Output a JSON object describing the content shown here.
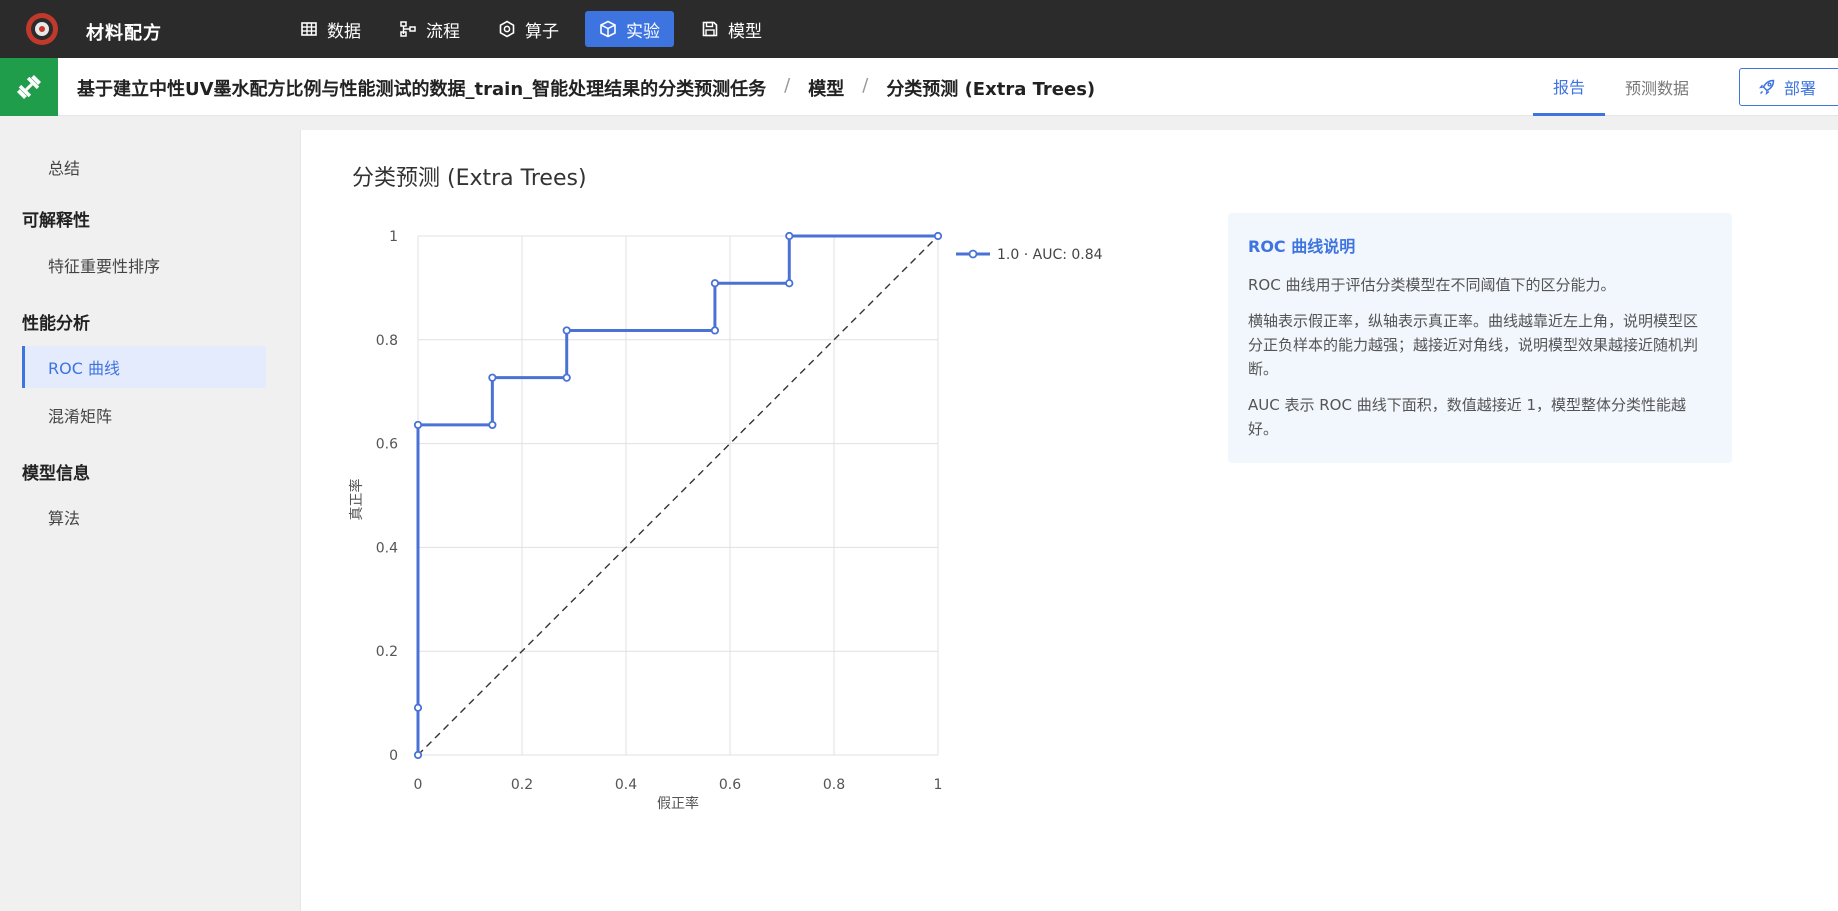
{
  "app": {
    "brand": "材料配方"
  },
  "nav": [
    {
      "label": "数据",
      "icon": "table-icon"
    },
    {
      "label": "流程",
      "icon": "flow-icon"
    },
    {
      "label": "算子",
      "icon": "operator-icon"
    },
    {
      "label": "实验",
      "icon": "cube-icon",
      "active": true
    },
    {
      "label": "模型",
      "icon": "save-icon"
    }
  ],
  "breadcrumb": {
    "task": "基于建立中性UV墨水配方比例与性能测试的数据_train_智能处理结果的分类预测任务",
    "sep": "/",
    "model": "模型",
    "current": "分类预测 (Extra Trees)"
  },
  "tabs": {
    "report": "报告",
    "predict": "预测数据"
  },
  "deploy_label": "部署",
  "sidebar": {
    "summary": "总结",
    "explain_group": "可解释性",
    "feature_rank": "特征重要性排序",
    "perf_group": "性能分析",
    "roc": "ROC 曲线",
    "confusion": "混淆矩阵",
    "model_group": "模型信息",
    "algorithm": "算法"
  },
  "main": {
    "title": "分类预测 (Extra Trees)"
  },
  "info": {
    "title": "ROC 曲线说明",
    "p1": "ROC 曲线用于评估分类模型在不同阈值下的区分能力。",
    "p2": "横轴表示假正率，纵轴表示真正率。曲线越靠近左上角，说明模型区分正负样本的能力越强；越接近对角线，说明模型效果越接近随机判断。",
    "p3": "AUC 表示 ROC 曲线下面积，数值越接近 1，模型整体分类性能越好。"
  },
  "colors": {
    "accent": "#3e74e0",
    "line": "#4a72d6",
    "green": "#1f9d4b"
  },
  "chart_data": {
    "type": "line",
    "xlabel": "假正率",
    "ylabel": "真正率",
    "xlim": [
      0,
      1
    ],
    "ylim": [
      0,
      1
    ],
    "xticks": [
      "0",
      "0.2",
      "0.4",
      "0.6",
      "0.8",
      "1"
    ],
    "yticks": [
      "0",
      "0.2",
      "0.4",
      "0.6",
      "0.8",
      "1"
    ],
    "grid": true,
    "legend_position": "top-right",
    "series": [
      {
        "name": "1.0 · AUC: 0.84",
        "x": [
          0,
          0,
          0,
          0.143,
          0.143,
          0.286,
          0.286,
          0.571,
          0.571,
          0.714,
          0.714,
          1
        ],
        "y": [
          0,
          0.091,
          0.636,
          0.636,
          0.727,
          0.727,
          0.818,
          0.818,
          0.909,
          0.909,
          1,
          1
        ]
      }
    ],
    "reference_line": {
      "x": [
        0,
        1
      ],
      "y": [
        0,
        1
      ]
    }
  }
}
